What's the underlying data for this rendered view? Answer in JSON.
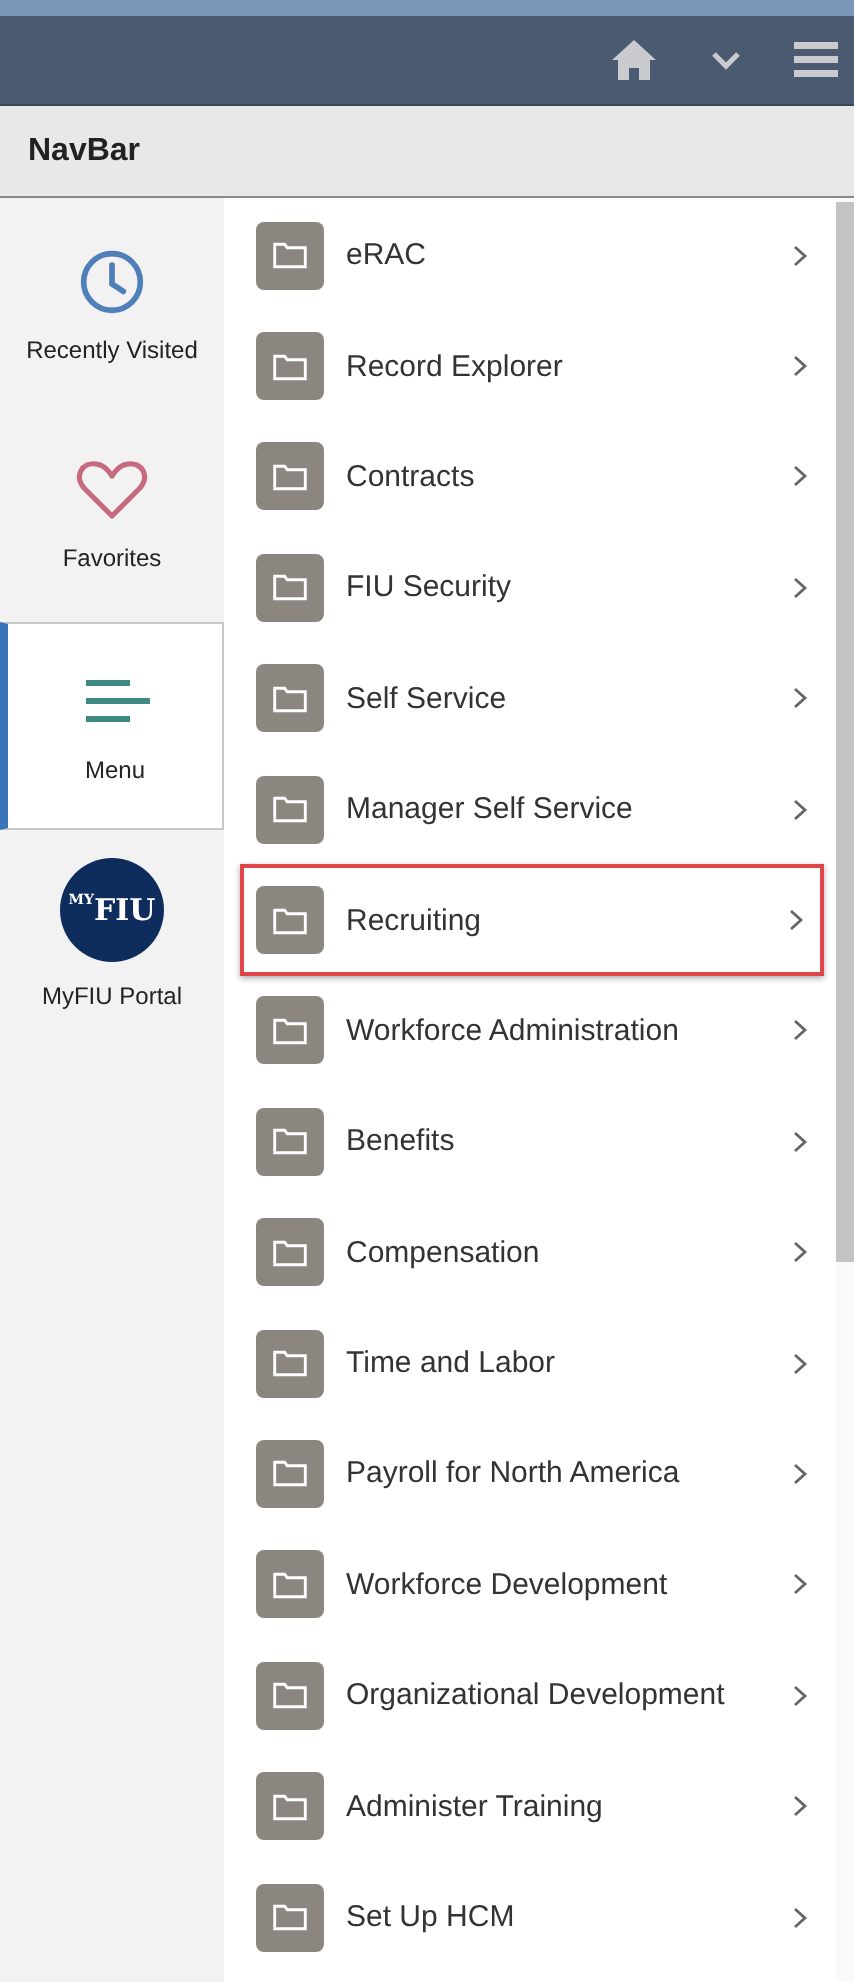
{
  "header": {
    "title": "NavBar"
  },
  "sidebar": {
    "items": [
      {
        "kind": "clock",
        "label": "Recently Visited",
        "selected": false
      },
      {
        "kind": "heart",
        "label": "Favorites",
        "selected": false
      },
      {
        "kind": "menu",
        "label": "Menu",
        "selected": true
      },
      {
        "kind": "logo",
        "label": "MyFIU Portal",
        "selected": false,
        "logo_small": "MY",
        "logo_main": "FIU"
      }
    ]
  },
  "menu_items": [
    {
      "label": "eRAC",
      "highlighted": false
    },
    {
      "label": "Record Explorer",
      "highlighted": false
    },
    {
      "label": "Contracts",
      "highlighted": false
    },
    {
      "label": "FIU Security",
      "highlighted": false
    },
    {
      "label": "Self Service",
      "highlighted": false
    },
    {
      "label": "Manager Self Service",
      "highlighted": false
    },
    {
      "label": "Recruiting",
      "highlighted": true
    },
    {
      "label": "Workforce Administration",
      "highlighted": false
    },
    {
      "label": "Benefits",
      "highlighted": false
    },
    {
      "label": "Compensation",
      "highlighted": false
    },
    {
      "label": "Time and Labor",
      "highlighted": false
    },
    {
      "label": "Payroll for North America",
      "highlighted": false
    },
    {
      "label": "Workforce Development",
      "highlighted": false
    },
    {
      "label": "Organizational Development",
      "highlighted": false
    },
    {
      "label": "Administer Training",
      "highlighted": false
    },
    {
      "label": "Set Up HCM",
      "highlighted": false
    }
  ]
}
